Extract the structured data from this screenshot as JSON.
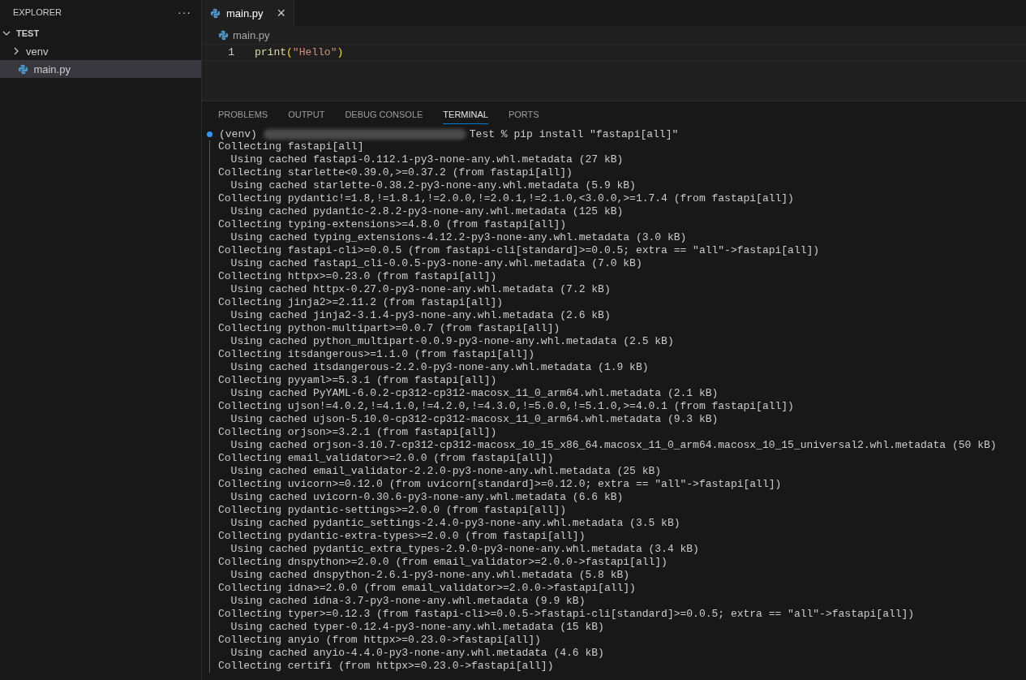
{
  "sidebar": {
    "title": "EXPLORER",
    "more": "···",
    "tree": [
      {
        "label": "TEST",
        "kind": "folder",
        "expanded": true,
        "selected": false,
        "children": [
          {
            "label": "venv",
            "kind": "folder",
            "expanded": false,
            "selected": false
          },
          {
            "label": "main.py",
            "kind": "python",
            "selected": true
          }
        ]
      }
    ]
  },
  "editor": {
    "tabs": [
      {
        "label": "main.py",
        "selected": true,
        "close": "×"
      }
    ],
    "breadcrumb": "main.py",
    "lines": [
      {
        "number": "1",
        "tokens": [
          {
            "kind": "function",
            "text": "print"
          },
          {
            "kind": "bracket",
            "text": "("
          },
          {
            "kind": "string",
            "text": "\"Hello\""
          },
          {
            "kind": "bracket",
            "text": ")"
          }
        ]
      }
    ]
  },
  "panel": {
    "tabs": [
      {
        "label": "PROBLEMS",
        "selected": false
      },
      {
        "label": "OUTPUT",
        "selected": false
      },
      {
        "label": "DEBUG CONSOLE",
        "selected": false
      },
      {
        "label": "TERMINAL",
        "selected": true
      },
      {
        "label": "PORTS",
        "selected": false
      }
    ],
    "terminal": {
      "prompt_env": "(venv)",
      "prompt_command": "Test % pip install \"fastapi[all]\"",
      "lines": [
        "Collecting fastapi[all]",
        "  Using cached fastapi-0.112.1-py3-none-any.whl.metadata (27 kB)",
        "Collecting starlette<0.39.0,>=0.37.2 (from fastapi[all])",
        "  Using cached starlette-0.38.2-py3-none-any.whl.metadata (5.9 kB)",
        "Collecting pydantic!=1.8,!=1.8.1,!=2.0.0,!=2.0.1,!=2.1.0,<3.0.0,>=1.7.4 (from fastapi[all])",
        "  Using cached pydantic-2.8.2-py3-none-any.whl.metadata (125 kB)",
        "Collecting typing-extensions>=4.8.0 (from fastapi[all])",
        "  Using cached typing_extensions-4.12.2-py3-none-any.whl.metadata (3.0 kB)",
        "Collecting fastapi-cli>=0.0.5 (from fastapi-cli[standard]>=0.0.5; extra == \"all\"->fastapi[all])",
        "  Using cached fastapi_cli-0.0.5-py3-none-any.whl.metadata (7.0 kB)",
        "Collecting httpx>=0.23.0 (from fastapi[all])",
        "  Using cached httpx-0.27.0-py3-none-any.whl.metadata (7.2 kB)",
        "Collecting jinja2>=2.11.2 (from fastapi[all])",
        "  Using cached jinja2-3.1.4-py3-none-any.whl.metadata (2.6 kB)",
        "Collecting python-multipart>=0.0.7 (from fastapi[all])",
        "  Using cached python_multipart-0.0.9-py3-none-any.whl.metadata (2.5 kB)",
        "Collecting itsdangerous>=1.1.0 (from fastapi[all])",
        "  Using cached itsdangerous-2.2.0-py3-none-any.whl.metadata (1.9 kB)",
        "Collecting pyyaml>=5.3.1 (from fastapi[all])",
        "  Using cached PyYAML-6.0.2-cp312-cp312-macosx_11_0_arm64.whl.metadata (2.1 kB)",
        "Collecting ujson!=4.0.2,!=4.1.0,!=4.2.0,!=4.3.0,!=5.0.0,!=5.1.0,>=4.0.1 (from fastapi[all])",
        "  Using cached ujson-5.10.0-cp312-cp312-macosx_11_0_arm64.whl.metadata (9.3 kB)",
        "Collecting orjson>=3.2.1 (from fastapi[all])",
        "  Using cached orjson-3.10.7-cp312-cp312-macosx_10_15_x86_64.macosx_11_0_arm64.macosx_10_15_universal2.whl.metadata (50 kB)",
        "Collecting email_validator>=2.0.0 (from fastapi[all])",
        "  Using cached email_validator-2.2.0-py3-none-any.whl.metadata (25 kB)",
        "Collecting uvicorn>=0.12.0 (from uvicorn[standard]>=0.12.0; extra == \"all\"->fastapi[all])",
        "  Using cached uvicorn-0.30.6-py3-none-any.whl.metadata (6.6 kB)",
        "Collecting pydantic-settings>=2.0.0 (from fastapi[all])",
        "  Using cached pydantic_settings-2.4.0-py3-none-any.whl.metadata (3.5 kB)",
        "Collecting pydantic-extra-types>=2.0.0 (from fastapi[all])",
        "  Using cached pydantic_extra_types-2.9.0-py3-none-any.whl.metadata (3.4 kB)",
        "Collecting dnspython>=2.0.0 (from email_validator>=2.0.0->fastapi[all])",
        "  Using cached dnspython-2.6.1-py3-none-any.whl.metadata (5.8 kB)",
        "Collecting idna>=2.0.0 (from email_validator>=2.0.0->fastapi[all])",
        "  Using cached idna-3.7-py3-none-any.whl.metadata (9.9 kB)",
        "Collecting typer>=0.12.3 (from fastapi-cli>=0.0.5->fastapi-cli[standard]>=0.0.5; extra == \"all\"->fastapi[all])",
        "  Using cached typer-0.12.4-py3-none-any.whl.metadata (15 kB)",
        "Collecting anyio (from httpx>=0.23.0->fastapi[all])",
        "  Using cached anyio-4.4.0-py3-none-any.whl.metadata (4.6 kB)",
        "Collecting certifi (from httpx>=0.23.0->fastapi[all])"
      ]
    }
  }
}
